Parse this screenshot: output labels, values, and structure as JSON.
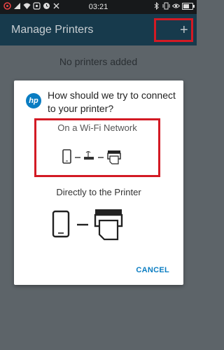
{
  "status_bar": {
    "time": "03:21",
    "icons_left": [
      "carrier-icon",
      "signal-icon",
      "wifi-icon",
      "notification-icon",
      "clock-icon",
      "cast-icon"
    ],
    "icons_right": [
      "bluetooth-icon",
      "vibrate-icon",
      "eye-icon",
      "battery-icon"
    ]
  },
  "app_bar": {
    "title": "Manage Printers",
    "add_label": "+"
  },
  "empty_message": "No printers added",
  "dialog": {
    "logo_text": "hp",
    "title": "How should we try to connect to your printer?",
    "wifi_option_label": "On a Wi-Fi Network",
    "direct_option_label": "Directly to the Printer",
    "cancel_label": "CANCEL"
  },
  "colors": {
    "app_bar": "#173a4c",
    "highlight": "#d31a24",
    "accent": "#0a7dc2",
    "scrim": "#5d6469"
  }
}
